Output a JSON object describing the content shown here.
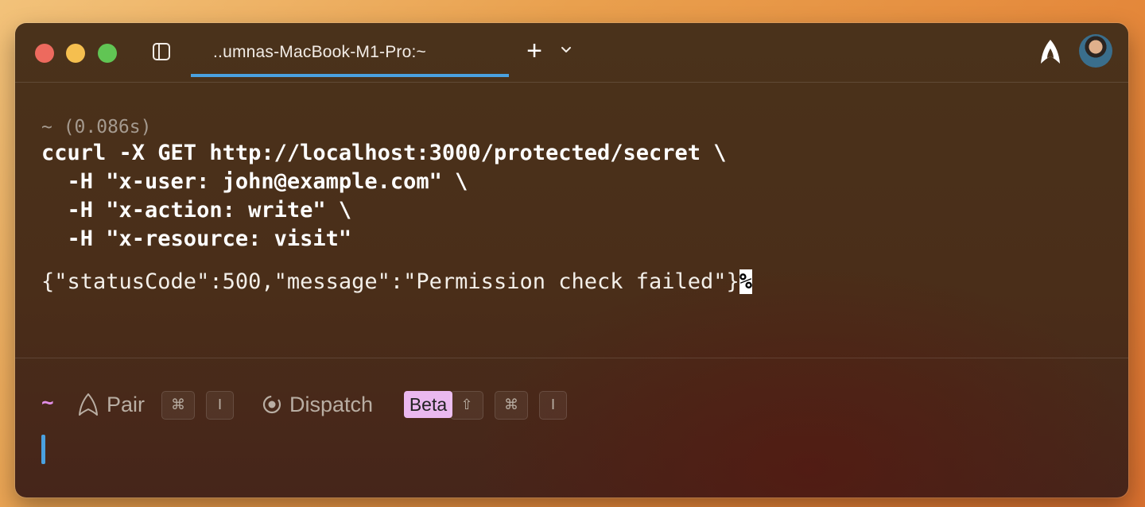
{
  "colors": {
    "tab_accent": "#4aa1e0",
    "cursor": "#4aa1e0",
    "prompt_tilde": "#e28fe8",
    "beta_badge": "#eab8ef",
    "traffic_red": "#ed6a5e",
    "traffic_yellow": "#f5bf4f",
    "traffic_green": "#61c554"
  },
  "titlebar": {
    "tab_title": "..umnas-MacBook-M1-Pro:~",
    "new_tab_label": "+",
    "icons": [
      "sidebar-toggle-icon",
      "chevron-down-icon",
      "warp-logo-icon",
      "user-avatar"
    ]
  },
  "block": {
    "prompt_meta": "~ (0.086s)",
    "command_lines": [
      "ccurl -X GET http://localhost:3000/protected/secret \\",
      "  -H \"x-user: john@example.com\" \\",
      "  -H \"x-action: write\" \\",
      "  -H \"x-resource: visit\""
    ],
    "output_text": "{\"statusCode\":500,\"message\":\"Permission check failed\"}",
    "output_end_marker": "%"
  },
  "input": {
    "prompt_symbol": "~",
    "pair_label": "Pair",
    "pair_keys": [
      "⌘",
      "I"
    ],
    "dispatch_label": "Dispatch",
    "beta_label": "Beta",
    "dispatch_keys": [
      "⇧",
      "⌘",
      "I"
    ]
  }
}
